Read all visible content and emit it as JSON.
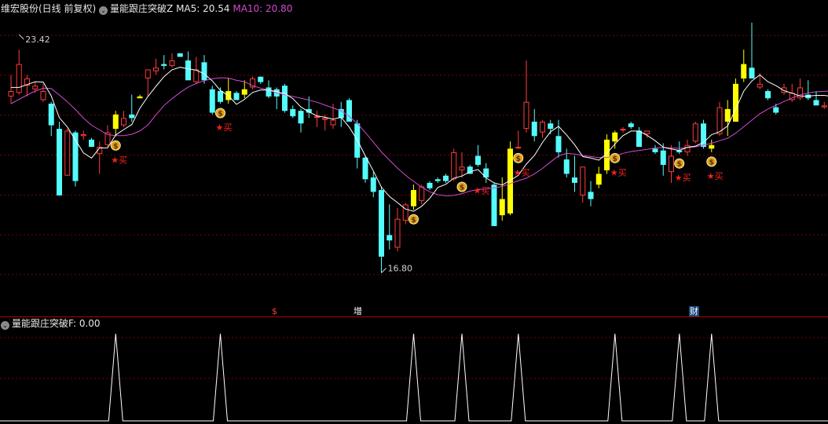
{
  "header": {
    "stock_name": "维宏股份(日线 前复权)",
    "indicator_name": "量能跟庄突破Z",
    "ma5_label": "MA5:",
    "ma5_value": "20.54",
    "ma10_label": "MA10:",
    "ma10_value": "20.80"
  },
  "sub_header": {
    "indicator_name": "量能跟庄突破F",
    "value_text": ": 0.00"
  },
  "price_labels": {
    "high": "23.42",
    "low": "16.80"
  },
  "event_markers": [
    {
      "text": "$",
      "color": "#ff3b3b"
    },
    {
      "text": "增",
      "color": "#ffffff"
    },
    {
      "text": "财",
      "color": "#ffffff"
    }
  ],
  "buy_label": "★买",
  "colors": {
    "background": "#000000",
    "up": "#ff3b3b",
    "down": "#54fcfc",
    "signal": "#ffff00",
    "ma5": "#ffffff",
    "ma10": "#d24ad2",
    "grid": "#7a0000",
    "buy_text": "#ff2020",
    "volume_line": "#ffffff"
  },
  "chart_data": [
    {
      "type": "candlestick",
      "name": "price",
      "grid": true,
      "ylim": [
        16.2,
        23.9
      ],
      "high_marker": 23.42,
      "low_marker": 16.8,
      "candles": [
        [
          21.7,
          22.3,
          21.5,
          21.85
        ],
        [
          21.8,
          23.0,
          21.75,
          22.6
        ],
        [
          22.0,
          22.3,
          21.7,
          22.2
        ],
        [
          21.9,
          22.1,
          21.8,
          22.0
        ],
        [
          21.6,
          22.05,
          21.55,
          21.85
        ],
        [
          21.5,
          21.55,
          20.6,
          20.9
        ],
        [
          20.8,
          21.0,
          18.95,
          18.95
        ],
        [
          19.5,
          20.8,
          19.5,
          20.75
        ],
        [
          20.7,
          20.75,
          19.2,
          19.35
        ],
        [
          20.6,
          20.75,
          20.5,
          20.65
        ],
        [
          20.5,
          20.55,
          20.3,
          20.3
        ],
        [
          20.1,
          20.45,
          19.55,
          20.3
        ],
        [
          20.35,
          20.9,
          20.3,
          20.7
        ],
        [
          20.8,
          21.3,
          20.6,
          21.2
        ],
        [
          20.9,
          21.3,
          20.85,
          21.1
        ],
        [
          21.2,
          21.75,
          21.0,
          21.1
        ],
        [
          21.65,
          21.75,
          21.65,
          21.7
        ],
        [
          22.2,
          22.45,
          21.7,
          22.45
        ],
        [
          22.4,
          22.75,
          22.3,
          22.5
        ],
        [
          22.6,
          22.85,
          22.45,
          22.55
        ],
        [
          22.55,
          22.9,
          22.5,
          22.7
        ],
        [
          22.9,
          22.9,
          22.8,
          22.8
        ],
        [
          22.7,
          22.95,
          22.15,
          22.15
        ],
        [
          22.1,
          22.8,
          22.05,
          22.45
        ],
        [
          22.65,
          22.85,
          22.05,
          22.15
        ],
        [
          21.9,
          22.0,
          21.2,
          21.25
        ],
        [
          21.85,
          21.95,
          21.5,
          21.55
        ],
        [
          21.6,
          22.2,
          21.5,
          21.85
        ],
        [
          21.8,
          21.85,
          21.6,
          21.6
        ],
        [
          21.75,
          22.15,
          21.65,
          21.9
        ],
        [
          21.95,
          22.25,
          21.9,
          22.2
        ],
        [
          22.25,
          22.25,
          22.05,
          22.1
        ],
        [
          21.95,
          22.15,
          21.65,
          21.7
        ],
        [
          21.9,
          21.95,
          21.35,
          21.7
        ],
        [
          22.0,
          22.05,
          21.25,
          21.3
        ],
        [
          21.35,
          21.45,
          21.1,
          21.15
        ],
        [
          21.3,
          21.35,
          20.7,
          20.95
        ],
        [
          21.35,
          21.7,
          21.1,
          21.25
        ],
        [
          21.15,
          21.3,
          20.85,
          21.15
        ],
        [
          21.05,
          21.2,
          20.75,
          21.1
        ],
        [
          20.9,
          21.5,
          20.8,
          21.05
        ],
        [
          21.35,
          21.55,
          20.85,
          21.1
        ],
        [
          21.6,
          21.65,
          21.0,
          21.0
        ],
        [
          20.95,
          21.05,
          19.7,
          20.0
        ],
        [
          20.0,
          20.05,
          19.3,
          19.4
        ],
        [
          19.45,
          19.6,
          18.9,
          19.05
        ],
        [
          19.1,
          19.2,
          16.8,
          17.25
        ],
        [
          17.85,
          18.7,
          17.45,
          17.7
        ],
        [
          17.5,
          18.6,
          17.4,
          18.3
        ],
        [
          18.25,
          18.75,
          18.15,
          18.7
        ],
        [
          18.65,
          19.25,
          18.55,
          19.1
        ],
        [
          18.8,
          19.25,
          18.7,
          19.2
        ],
        [
          19.3,
          19.35,
          19.1,
          19.15
        ],
        [
          19.4,
          19.45,
          19.3,
          19.35
        ],
        [
          19.5,
          19.55,
          19.3,
          19.35
        ],
        [
          19.4,
          20.25,
          19.35,
          20.15
        ],
        [
          19.65,
          20.15,
          19.45,
          19.75
        ],
        [
          19.75,
          19.8,
          19.55,
          19.55
        ],
        [
          20.05,
          20.35,
          19.75,
          19.8
        ],
        [
          19.7,
          19.85,
          19.3,
          19.45
        ],
        [
          19.25,
          19.3,
          18.1,
          18.1
        ],
        [
          18.4,
          19.45,
          18.25,
          18.85
        ],
        [
          18.45,
          20.45,
          18.4,
          20.25
        ],
        [
          20.3,
          20.75,
          20.25,
          20.3
        ],
        [
          20.8,
          22.7,
          20.7,
          21.55
        ],
        [
          21.0,
          21.35,
          20.45,
          20.6
        ],
        [
          20.7,
          21.05,
          20.55,
          21.0
        ],
        [
          20.95,
          21.05,
          20.65,
          20.8
        ],
        [
          20.6,
          21.05,
          20.0,
          20.15
        ],
        [
          19.95,
          20.25,
          19.45,
          19.55
        ],
        [
          19.45,
          20.05,
          19.05,
          19.3
        ],
        [
          18.95,
          19.75,
          18.75,
          19.75
        ],
        [
          19.05,
          19.35,
          18.65,
          18.85
        ],
        [
          19.25,
          19.75,
          19.15,
          19.55
        ],
        [
          19.65,
          20.65,
          19.55,
          20.5
        ],
        [
          20.45,
          20.75,
          20.25,
          20.7
        ],
        [
          20.8,
          20.85,
          20.7,
          20.8
        ],
        [
          20.95,
          21.0,
          20.8,
          20.85
        ],
        [
          20.75,
          20.85,
          20.3,
          20.3
        ],
        [
          20.65,
          20.75,
          20.55,
          20.75
        ],
        [
          20.25,
          20.35,
          20.1,
          20.15
        ],
        [
          20.2,
          20.4,
          19.5,
          19.8
        ],
        [
          19.6,
          20.35,
          19.3,
          20.05
        ],
        [
          20.2,
          20.45,
          20.1,
          20.15
        ],
        [
          20.15,
          20.5,
          20.05,
          20.35
        ],
        [
          20.45,
          21.0,
          20.4,
          20.95
        ],
        [
          20.95,
          21.05,
          20.25,
          20.3
        ],
        [
          20.25,
          20.5,
          20.15,
          20.35
        ],
        [
          20.65,
          21.55,
          20.6,
          21.4
        ],
        [
          21.0,
          21.6,
          20.6,
          21.35
        ],
        [
          21.0,
          22.2,
          21.0,
          22.05
        ],
        [
          22.2,
          23.0,
          22.1,
          22.6
        ],
        [
          22.5,
          23.75,
          22.35,
          22.2
        ],
        [
          21.95,
          22.35,
          21.9,
          22.05
        ],
        [
          21.85,
          21.9,
          21.6,
          21.65
        ],
        [
          21.4,
          21.5,
          21.2,
          21.25
        ],
        [
          21.8,
          22.05,
          21.75,
          21.95
        ],
        [
          21.6,
          22.05,
          21.55,
          21.8
        ],
        [
          21.65,
          22.2,
          21.6,
          21.95
        ],
        [
          21.75,
          22.15,
          21.6,
          21.65
        ],
        [
          21.6,
          21.85,
          21.5,
          21.45
        ],
        [
          21.4,
          21.55,
          21.35,
          21.45
        ],
        [
          21.35,
          21.55,
          21.35,
          21.6
        ],
        [
          21.25,
          21.55,
          21.3,
          21.7
        ],
        [
          21.45,
          21.85,
          21.3,
          21.75
        ]
      ],
      "ma5": [
        21.95,
        21.95,
        22.03,
        22.11,
        22.1,
        21.71,
        21.11,
        20.85,
        20.49,
        20.13,
        19.99,
        20.27,
        20.27,
        20.63,
        20.78,
        20.92,
        21.37,
        21.7,
        21.98,
        22.25,
        22.44,
        22.51,
        22.47,
        22.43,
        22.33,
        22.13,
        21.87,
        21.72,
        21.48,
        21.62,
        21.81,
        21.88,
        21.88,
        21.83,
        21.78,
        21.64,
        21.41,
        21.27,
        21.16,
        21.12,
        21.07,
        21.12,
        20.85,
        20.49,
        20.05,
        19.63,
        19.18,
        18.92,
        18.75,
        18.57,
        18.51,
        18.65,
        18.87,
        19.17,
        19.26,
        19.43,
        19.49,
        19.61,
        19.67,
        19.44,
        19.3,
        19.24,
        19.37,
        19.51,
        19.82,
        20.06,
        20.42,
        20.72,
        20.87,
        20.63,
        20.36,
        20.03,
        19.99,
        19.93,
        20.12,
        20.38,
        20.61,
        20.74,
        20.74,
        20.62,
        20.47,
        20.29,
        20.24,
        20.2,
        20.29,
        20.32,
        20.42,
        20.64,
        20.72,
        20.88,
        21.35,
        21.85,
        22.13,
        22.3,
        22.11,
        22.0,
        21.86,
        21.79,
        21.71,
        21.71,
        21.73,
        21.73,
        21.7,
        21.68
      ],
      "ma10": [
        21.5,
        21.62,
        21.74,
        21.85,
        21.93,
        21.92,
        21.74,
        21.55,
        21.34,
        21.1,
        20.9,
        20.77,
        20.64,
        20.61,
        20.61,
        20.65,
        20.74,
        20.91,
        21.19,
        21.45,
        21.64,
        21.81,
        21.96,
        22.06,
        22.14,
        22.19,
        22.22,
        22.21,
        22.15,
        22.11,
        22.0,
        21.93,
        21.88,
        21.8,
        21.75,
        21.7,
        21.65,
        21.6,
        21.54,
        21.46,
        21.38,
        21.3,
        21.15,
        20.95,
        20.7,
        20.43,
        20.16,
        19.93,
        19.71,
        19.51,
        19.34,
        19.18,
        19.05,
        18.97,
        18.94,
        18.95,
        19.0,
        19.07,
        19.12,
        19.13,
        19.16,
        19.2,
        19.28,
        19.36,
        19.43,
        19.55,
        19.7,
        19.88,
        20.05,
        20.12,
        20.1,
        20.06,
        20.03,
        20.0,
        20.0,
        20.05,
        20.12,
        20.17,
        20.2,
        20.23,
        20.27,
        20.28,
        20.27,
        20.26,
        20.28,
        20.3,
        20.35,
        20.4,
        20.47,
        20.54,
        20.68,
        20.86,
        21.04,
        21.22,
        21.35,
        21.46,
        21.56,
        21.66,
        21.74,
        21.8,
        21.83,
        21.84,
        21.86,
        21.87
      ],
      "signal_indices": [
        13,
        16,
        26,
        27,
        29,
        50,
        58,
        59,
        60,
        61,
        62,
        63,
        65,
        73,
        74,
        75,
        76,
        80,
        83,
        87,
        89,
        90,
        91,
        92
      ],
      "buy_signals": [
        {
          "index": 13,
          "label": "★买"
        },
        {
          "index": 26,
          "label": "★买"
        },
        {
          "index": 58,
          "label": "★买"
        },
        {
          "index": 63,
          "label": "★买"
        },
        {
          "index": 75,
          "label": "★买"
        },
        {
          "index": 83,
          "label": "★买"
        },
        {
          "index": 87,
          "label": "★买"
        }
      ],
      "money_bag_indices": [
        13,
        26,
        50,
        56,
        63,
        75,
        83,
        87
      ]
    },
    {
      "type": "line",
      "name": "量能跟庄突破F",
      "ylim": [
        0,
        1
      ],
      "values_desc": "pulse",
      "pulse_indices": [
        13,
        26,
        50,
        56,
        63,
        75,
        83,
        87
      ],
      "pulse_value": 1,
      "baseline": 0
    }
  ]
}
